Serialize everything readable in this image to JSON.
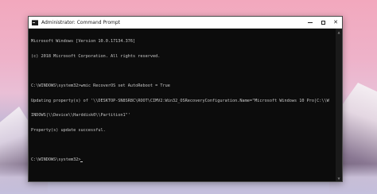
{
  "window": {
    "title": "Administrator: Command Prompt",
    "minimize_icon": "minimize-icon",
    "maximize_icon": "maximize-icon",
    "close_label": "✕"
  },
  "console": {
    "lines": [
      "Microsoft Windows [Version 10.0.17134.376]",
      "(c) 2018 Microsoft Corporation. All rights reserved.",
      "",
      "C:\\WINDOWS\\system32>wmic RecoverOS set AutoReboot = True",
      "Updating property(s) of '\\\\DESKTOP-SN8SR8C\\ROOT\\CIMV2:Win32_OSRecoveryConfiguration.Name=\"Microsoft Windows 10 Pro|C:\\\\W",
      "INDOWS|\\\\Device\\\\Harddisk0\\\\Partition1\"'",
      "Property(s) update successful.",
      "",
      "C:\\WINDOWS\\system32>"
    ]
  },
  "colors": {
    "console_bg": "#0c0c0c",
    "console_text": "#c8c8c8",
    "titlebar_bg": "#ffffff"
  }
}
